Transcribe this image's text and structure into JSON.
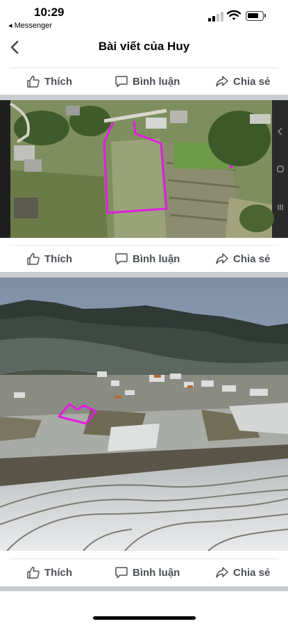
{
  "status_bar": {
    "time": "10:29",
    "back_app": "◂ Messenger"
  },
  "nav": {
    "title": "Bài viết của Huy"
  },
  "actions": {
    "like": "Thích",
    "comment": "Bình luận",
    "share": "Chia sẻ"
  },
  "colors": {
    "outline": "#e21ee0",
    "icon": "#4b4f56",
    "separator": "#c9ccd1"
  },
  "icons": [
    "chevron-left-icon",
    "thumbs-up-icon",
    "comment-icon",
    "share-icon"
  ]
}
